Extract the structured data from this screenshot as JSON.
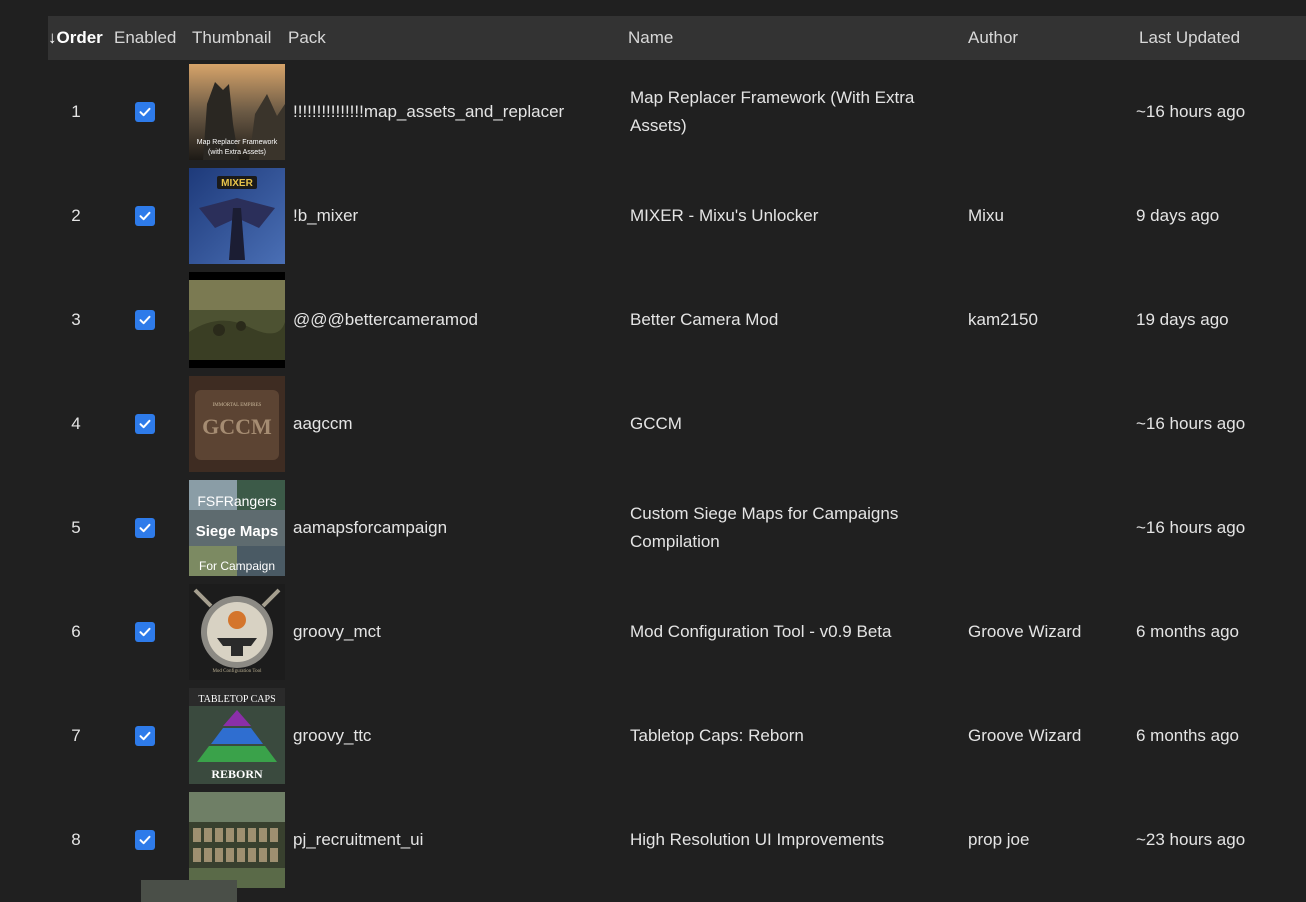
{
  "columns": {
    "order": "↓Order",
    "enabled": "Enabled",
    "thumbnail": "Thumbnail",
    "pack": "Pack",
    "name": "Name",
    "author": "Author",
    "last_updated": "Last Updated"
  },
  "colors": {
    "header_bg": "#333333",
    "page_bg": "#202020",
    "checkbox": "#2e7bea"
  },
  "rows": [
    {
      "order": "1",
      "enabled": true,
      "pack": "!!!!!!!!!!!!!!!map_assets_and_replacer",
      "name": "Map Replacer Framework (With Extra Assets)",
      "author": "",
      "updated": "~16 hours ago",
      "thumb_text": [
        "Map Replacer Framework",
        "(with Extra Assets)"
      ]
    },
    {
      "order": "2",
      "enabled": true,
      "pack": "!b_mixer",
      "name": "MIXER - Mixu's Unlocker",
      "author": "Mixu",
      "updated": "9 days ago",
      "thumb_text": [
        "MIXER"
      ]
    },
    {
      "order": "3",
      "enabled": true,
      "pack": "@@@bettercameramod",
      "name": "Better Camera Mod",
      "author": "kam2150",
      "updated": "19 days ago",
      "thumb_text": []
    },
    {
      "order": "4",
      "enabled": true,
      "pack": "aagccm",
      "name": "GCCM",
      "author": "",
      "updated": "~16 hours ago",
      "thumb_text": [
        "IMMORTAL EMPIRES",
        "GCCM"
      ]
    },
    {
      "order": "5",
      "enabled": true,
      "pack": "aamapsforcampaign",
      "name": "Custom Siege Maps for Campaigns Compilation",
      "author": "",
      "updated": "~16 hours ago",
      "thumb_text": [
        "FSFRangers",
        "Siege Maps",
        "For Campaign"
      ]
    },
    {
      "order": "6",
      "enabled": true,
      "pack": "groovy_mct",
      "name": "Mod Configuration Tool - v0.9 Beta",
      "author": "Groove Wizard",
      "updated": "6 months ago",
      "thumb_text": [
        "Mod Configuration Tool"
      ]
    },
    {
      "order": "7",
      "enabled": true,
      "pack": "groovy_ttc",
      "name": "Tabletop Caps: Reborn",
      "author": "Groove Wizard",
      "updated": "6 months ago",
      "thumb_text": [
        "TABLETOP CAPS",
        "REBORN"
      ]
    },
    {
      "order": "8",
      "enabled": true,
      "pack": "pj_recruitment_ui",
      "name": "High Resolution UI Improvements",
      "author": "prop joe",
      "updated": "~23 hours ago",
      "thumb_text": []
    }
  ]
}
